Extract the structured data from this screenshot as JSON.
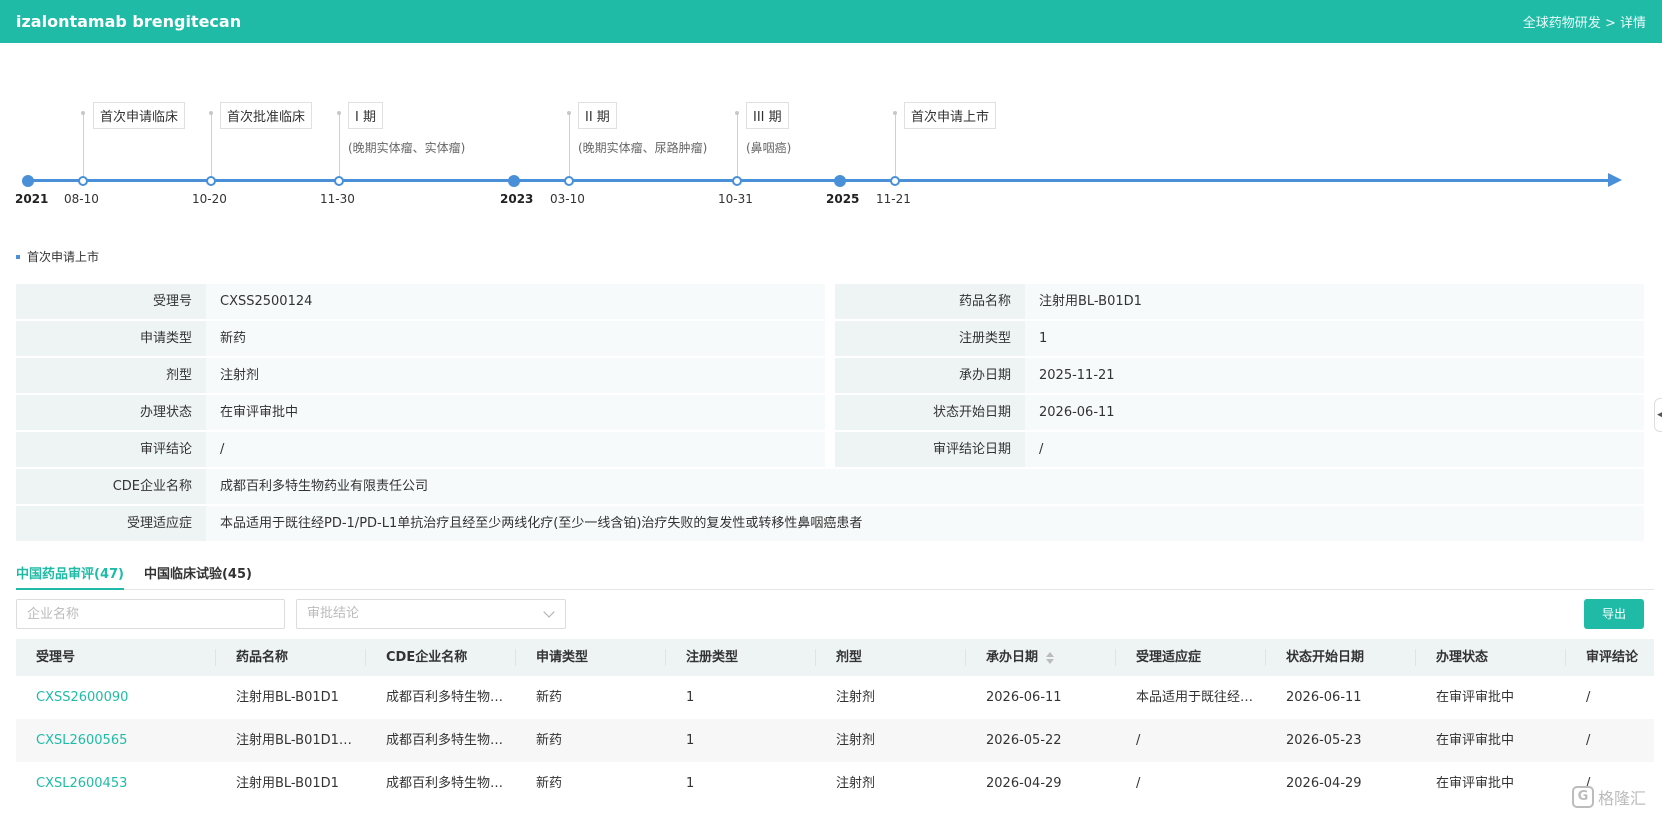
{
  "header": {
    "title": "izalontamab brengitecan",
    "breadcrumb_parent": "全球药物研发",
    "breadcrumb_sep": " > ",
    "breadcrumb_current": "详情"
  },
  "timeline": {
    "years": [
      "2021",
      "2023",
      "2025"
    ],
    "events": [
      {
        "date": "08-10",
        "label": "首次申请临床",
        "sub": ""
      },
      {
        "date": "10-20",
        "label": "首次批准临床",
        "sub": ""
      },
      {
        "date": "11-30",
        "label": "I 期",
        "sub": "(晚期实体瘤、实体瘤)"
      },
      {
        "date": "03-10",
        "label": "II 期",
        "sub": "(晚期实体瘤、尿路肿瘤)"
      },
      {
        "date": "10-31",
        "label": "III 期",
        "sub": "(鼻咽癌)"
      },
      {
        "date": "11-21",
        "label": "首次申请上市",
        "sub": ""
      }
    ]
  },
  "section_title": "首次申请上市",
  "info": {
    "accept_no_label": "受理号",
    "accept_no": "CXSS2500124",
    "drug_name_label": "药品名称",
    "drug_name": "注射用BL-B01D1",
    "apply_type_label": "申请类型",
    "apply_type": "新药",
    "reg_type_label": "注册类型",
    "reg_type": "1",
    "form_label": "剂型",
    "form": "注射剂",
    "handle_date_label": "承办日期",
    "handle_date": "2025-11-21",
    "status_label": "办理状态",
    "status": "在审评审批中",
    "status_date_label": "状态开始日期",
    "status_date": "2026-06-11",
    "conclusion_label": "审评结论",
    "conclusion": "/",
    "conclusion_date_label": "审评结论日期",
    "conclusion_date": "/",
    "company_label": "CDE企业名称",
    "company": "成都百利多特生物药业有限责任公司",
    "indication_label": "受理适应症",
    "indication": "本品适用于既往经PD-1/PD-L1单抗治疗且经至少两线化疗(至少一线含铂)治疗失败的复发性或转移性鼻咽癌患者"
  },
  "tabs": [
    {
      "label": "中国药品审评(47)",
      "active": true
    },
    {
      "label": "中国临床试验(45)",
      "active": false
    }
  ],
  "filters": {
    "company_placeholder": "企业名称",
    "conclusion_placeholder": "审批结论",
    "export_label": "导出"
  },
  "table": {
    "headers": [
      "受理号",
      "药品名称",
      "CDE企业名称",
      "申请类型",
      "注册类型",
      "剂型",
      "承办日期",
      "受理适应症",
      "状态开始日期",
      "办理状态",
      "审评结论"
    ],
    "rows": [
      [
        "CXSS2600090",
        "注射用BL-B01D1",
        "成都百利多特生物…",
        "新药",
        "1",
        "注射剂",
        "2026-06-11",
        "本品适用于既往经…",
        "2026-06-11",
        "在审评审批中",
        "/"
      ],
      [
        "CXSL2600565",
        "注射用BL-B01D1…",
        "成都百利多特生物…",
        "新药",
        "1",
        "注射剂",
        "2026-05-22",
        "/",
        "2026-05-23",
        "在审评审批中",
        "/"
      ],
      [
        "CXSL2600453",
        "注射用BL-B01D1",
        "成都百利多特生物…",
        "新药",
        "1",
        "注射剂",
        "2026-04-29",
        "/",
        "2026-04-29",
        "在审评审批中",
        "/"
      ]
    ]
  },
  "watermark": "格隆汇",
  "colors": {
    "accent": "#1fbba6",
    "timeline": "#4a90d9"
  }
}
